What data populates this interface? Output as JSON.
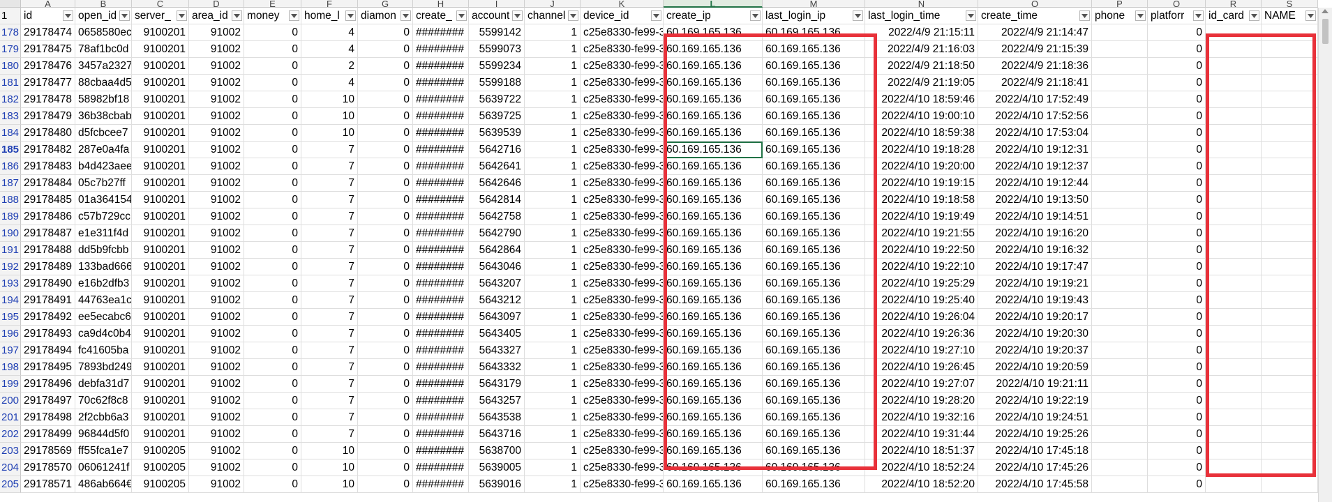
{
  "columns": [
    {
      "letter": "A",
      "header": "id",
      "kind": "num"
    },
    {
      "letter": "B",
      "header": "open_id",
      "kind": "txt"
    },
    {
      "letter": "C",
      "header": "server_",
      "kind": "num"
    },
    {
      "letter": "D",
      "header": "area_id",
      "kind": "num"
    },
    {
      "letter": "E",
      "header": "money",
      "kind": "num"
    },
    {
      "letter": "F",
      "header": "home_l",
      "kind": "num"
    },
    {
      "letter": "G",
      "header": "diamon",
      "kind": "num"
    },
    {
      "letter": "H",
      "header": "create_",
      "kind": "txt"
    },
    {
      "letter": "I",
      "header": "account",
      "kind": "num"
    },
    {
      "letter": "J",
      "header": "channel",
      "kind": "num"
    },
    {
      "letter": "K",
      "header": "device_id",
      "kind": "txt"
    },
    {
      "letter": "L",
      "header": "create_ip",
      "kind": "txt"
    },
    {
      "letter": "M",
      "header": "last_login_ip",
      "kind": "txt"
    },
    {
      "letter": "N",
      "header": "last_login_time",
      "kind": "num"
    },
    {
      "letter": "O",
      "header": "create_time",
      "kind": "num"
    },
    {
      "letter": "P",
      "header": "phone",
      "kind": "txt"
    },
    {
      "letter": "Q",
      "header": "platforr",
      "kind": "num"
    },
    {
      "letter": "R",
      "header": "id_card",
      "kind": "txt"
    },
    {
      "letter": "S",
      "header": "NAME",
      "kind": "txt"
    }
  ],
  "selected_column": "L",
  "active_row": "185",
  "header_row_number": "1",
  "rows": [
    {
      "n": "178",
      "id": "29178474",
      "open_id": "0658580ec",
      "server": "9100201",
      "area": "91002",
      "money": "0",
      "home": "4",
      "diamond": "0",
      "create": "########",
      "account": "5599142",
      "channel": "1",
      "device": "c25e8330-fe99-3",
      "create_ip": "60.169.165.136",
      "last_ip": "60.169.165.136",
      "last_time": "2022/4/9 21:15:11",
      "create_time": "2022/4/9 21:14:47",
      "phone": "",
      "platform": "0",
      "id_card": "",
      "name": ""
    },
    {
      "n": "179",
      "id": "29178475",
      "open_id": "78af1bc0d",
      "server": "9100201",
      "area": "91002",
      "money": "0",
      "home": "4",
      "diamond": "0",
      "create": "########",
      "account": "5599073",
      "channel": "1",
      "device": "c25e8330-fe99-3",
      "create_ip": "60.169.165.136",
      "last_ip": "60.169.165.136",
      "last_time": "2022/4/9 21:16:03",
      "create_time": "2022/4/9 21:15:39",
      "phone": "",
      "platform": "0",
      "id_card": "",
      "name": ""
    },
    {
      "n": "180",
      "id": "29178476",
      "open_id": "3457a2327",
      "server": "9100201",
      "area": "91002",
      "money": "0",
      "home": "2",
      "diamond": "0",
      "create": "########",
      "account": "5599234",
      "channel": "1",
      "device": "c25e8330-fe99-3",
      "create_ip": "60.169.165.136",
      "last_ip": "60.169.165.136",
      "last_time": "2022/4/9 21:18:50",
      "create_time": "2022/4/9 21:18:36",
      "phone": "",
      "platform": "0",
      "id_card": "",
      "name": ""
    },
    {
      "n": "181",
      "id": "29178477",
      "open_id": "88cbaa4d5",
      "server": "9100201",
      "area": "91002",
      "money": "0",
      "home": "4",
      "diamond": "0",
      "create": "########",
      "account": "5599188",
      "channel": "1",
      "device": "c25e8330-fe99-3",
      "create_ip": "60.169.165.136",
      "last_ip": "60.169.165.136",
      "last_time": "2022/4/9 21:19:05",
      "create_time": "2022/4/9 21:18:41",
      "phone": "",
      "platform": "0",
      "id_card": "",
      "name": ""
    },
    {
      "n": "182",
      "id": "29178478",
      "open_id": "58982bf18",
      "server": "9100201",
      "area": "91002",
      "money": "0",
      "home": "10",
      "diamond": "0",
      "create": "########",
      "account": "5639722",
      "channel": "1",
      "device": "c25e8330-fe99-3",
      "create_ip": "60.169.165.136",
      "last_ip": "60.169.165.136",
      "last_time": "2022/4/10 18:59:46",
      "create_time": "2022/4/10 17:52:49",
      "phone": "",
      "platform": "0",
      "id_card": "",
      "name": ""
    },
    {
      "n": "183",
      "id": "29178479",
      "open_id": "36b38cbab",
      "server": "9100201",
      "area": "91002",
      "money": "0",
      "home": "10",
      "diamond": "0",
      "create": "########",
      "account": "5639725",
      "channel": "1",
      "device": "c25e8330-fe99-3",
      "create_ip": "60.169.165.136",
      "last_ip": "60.169.165.136",
      "last_time": "2022/4/10 19:00:10",
      "create_time": "2022/4/10 17:52:56",
      "phone": "",
      "platform": "0",
      "id_card": "",
      "name": ""
    },
    {
      "n": "184",
      "id": "29178480",
      "open_id": "d5fcbcee7",
      "server": "9100201",
      "area": "91002",
      "money": "0",
      "home": "10",
      "diamond": "0",
      "create": "########",
      "account": "5639539",
      "channel": "1",
      "device": "c25e8330-fe99-3",
      "create_ip": "60.169.165.136",
      "last_ip": "60.169.165.136",
      "last_time": "2022/4/10 18:59:38",
      "create_time": "2022/4/10 17:53:04",
      "phone": "",
      "platform": "0",
      "id_card": "",
      "name": ""
    },
    {
      "n": "185",
      "id": "29178482",
      "open_id": "287e0a4fa",
      "server": "9100201",
      "area": "91002",
      "money": "0",
      "home": "7",
      "diamond": "0",
      "create": "########",
      "account": "5642716",
      "channel": "1",
      "device": "c25e8330-fe99-3",
      "create_ip": "60.169.165.136",
      "last_ip": "60.169.165.136",
      "last_time": "2022/4/10 19:18:28",
      "create_time": "2022/4/10 19:12:31",
      "phone": "",
      "platform": "0",
      "id_card": "",
      "name": ""
    },
    {
      "n": "186",
      "id": "29178483",
      "open_id": "b4d423aee",
      "server": "9100201",
      "area": "91002",
      "money": "0",
      "home": "7",
      "diamond": "0",
      "create": "########",
      "account": "5642641",
      "channel": "1",
      "device": "c25e8330-fe99-3",
      "create_ip": "60.169.165.136",
      "last_ip": "60.169.165.136",
      "last_time": "2022/4/10 19:20:00",
      "create_time": "2022/4/10 19:12:37",
      "phone": "",
      "platform": "0",
      "id_card": "",
      "name": ""
    },
    {
      "n": "187",
      "id": "29178484",
      "open_id": "05c7b27ff",
      "server": "9100201",
      "area": "91002",
      "money": "0",
      "home": "7",
      "diamond": "0",
      "create": "########",
      "account": "5642646",
      "channel": "1",
      "device": "c25e8330-fe99-3",
      "create_ip": "60.169.165.136",
      "last_ip": "60.169.165.136",
      "last_time": "2022/4/10 19:19:15",
      "create_time": "2022/4/10 19:12:44",
      "phone": "",
      "platform": "0",
      "id_card": "",
      "name": ""
    },
    {
      "n": "188",
      "id": "29178485",
      "open_id": "01a364154",
      "server": "9100201",
      "area": "91002",
      "money": "0",
      "home": "7",
      "diamond": "0",
      "create": "########",
      "account": "5642814",
      "channel": "1",
      "device": "c25e8330-fe99-3",
      "create_ip": "60.169.165.136",
      "last_ip": "60.169.165.136",
      "last_time": "2022/4/10 19:18:58",
      "create_time": "2022/4/10 19:13:50",
      "phone": "",
      "platform": "0",
      "id_card": "",
      "name": ""
    },
    {
      "n": "189",
      "id": "29178486",
      "open_id": "c57b729cc",
      "server": "9100201",
      "area": "91002",
      "money": "0",
      "home": "7",
      "diamond": "0",
      "create": "########",
      "account": "5642758",
      "channel": "1",
      "device": "c25e8330-fe99-3",
      "create_ip": "60.169.165.136",
      "last_ip": "60.169.165.136",
      "last_time": "2022/4/10 19:19:49",
      "create_time": "2022/4/10 19:14:51",
      "phone": "",
      "platform": "0",
      "id_card": "",
      "name": ""
    },
    {
      "n": "190",
      "id": "29178487",
      "open_id": "e1e311f4d",
      "server": "9100201",
      "area": "91002",
      "money": "0",
      "home": "7",
      "diamond": "0",
      "create": "########",
      "account": "5642790",
      "channel": "1",
      "device": "c25e8330-fe99-3",
      "create_ip": "60.169.165.136",
      "last_ip": "60.169.165.136",
      "last_time": "2022/4/10 19:21:55",
      "create_time": "2022/4/10 19:16:20",
      "phone": "",
      "platform": "0",
      "id_card": "",
      "name": ""
    },
    {
      "n": "191",
      "id": "29178488",
      "open_id": "dd5b9fcbb",
      "server": "9100201",
      "area": "91002",
      "money": "0",
      "home": "7",
      "diamond": "0",
      "create": "########",
      "account": "5642864",
      "channel": "1",
      "device": "c25e8330-fe99-3",
      "create_ip": "60.169.165.136",
      "last_ip": "60.169.165.136",
      "last_time": "2022/4/10 19:22:50",
      "create_time": "2022/4/10 19:16:32",
      "phone": "",
      "platform": "0",
      "id_card": "",
      "name": ""
    },
    {
      "n": "192",
      "id": "29178489",
      "open_id": "133bad666",
      "server": "9100201",
      "area": "91002",
      "money": "0",
      "home": "7",
      "diamond": "0",
      "create": "########",
      "account": "5643046",
      "channel": "1",
      "device": "c25e8330-fe99-3",
      "create_ip": "60.169.165.136",
      "last_ip": "60.169.165.136",
      "last_time": "2022/4/10 19:22:10",
      "create_time": "2022/4/10 19:17:47",
      "phone": "",
      "platform": "0",
      "id_card": "",
      "name": ""
    },
    {
      "n": "193",
      "id": "29178490",
      "open_id": "e16b2dfb3",
      "server": "9100201",
      "area": "91002",
      "money": "0",
      "home": "7",
      "diamond": "0",
      "create": "########",
      "account": "5643207",
      "channel": "1",
      "device": "c25e8330-fe99-3",
      "create_ip": "60.169.165.136",
      "last_ip": "60.169.165.136",
      "last_time": "2022/4/10 19:25:29",
      "create_time": "2022/4/10 19:19:21",
      "phone": "",
      "platform": "0",
      "id_card": "",
      "name": ""
    },
    {
      "n": "194",
      "id": "29178491",
      "open_id": "44763ea1c",
      "server": "9100201",
      "area": "91002",
      "money": "0",
      "home": "7",
      "diamond": "0",
      "create": "########",
      "account": "5643212",
      "channel": "1",
      "device": "c25e8330-fe99-3",
      "create_ip": "60.169.165.136",
      "last_ip": "60.169.165.136",
      "last_time": "2022/4/10 19:25:40",
      "create_time": "2022/4/10 19:19:43",
      "phone": "",
      "platform": "0",
      "id_card": "",
      "name": ""
    },
    {
      "n": "195",
      "id": "29178492",
      "open_id": "ee5ecabc6",
      "server": "9100201",
      "area": "91002",
      "money": "0",
      "home": "7",
      "diamond": "0",
      "create": "########",
      "account": "5643097",
      "channel": "1",
      "device": "c25e8330-fe99-3",
      "create_ip": "60.169.165.136",
      "last_ip": "60.169.165.136",
      "last_time": "2022/4/10 19:26:04",
      "create_time": "2022/4/10 19:20:17",
      "phone": "",
      "platform": "0",
      "id_card": "",
      "name": ""
    },
    {
      "n": "196",
      "id": "29178493",
      "open_id": "ca9d4c0b4",
      "server": "9100201",
      "area": "91002",
      "money": "0",
      "home": "7",
      "diamond": "0",
      "create": "########",
      "account": "5643405",
      "channel": "1",
      "device": "c25e8330-fe99-3",
      "create_ip": "60.169.165.136",
      "last_ip": "60.169.165.136",
      "last_time": "2022/4/10 19:26:36",
      "create_time": "2022/4/10 19:20:30",
      "phone": "",
      "platform": "0",
      "id_card": "",
      "name": ""
    },
    {
      "n": "197",
      "id": "29178494",
      "open_id": "fc41605ba",
      "server": "9100201",
      "area": "91002",
      "money": "0",
      "home": "7",
      "diamond": "0",
      "create": "########",
      "account": "5643327",
      "channel": "1",
      "device": "c25e8330-fe99-3",
      "create_ip": "60.169.165.136",
      "last_ip": "60.169.165.136",
      "last_time": "2022/4/10 19:27:10",
      "create_time": "2022/4/10 19:20:37",
      "phone": "",
      "platform": "0",
      "id_card": "",
      "name": ""
    },
    {
      "n": "198",
      "id": "29178495",
      "open_id": "7893bd249",
      "server": "9100201",
      "area": "91002",
      "money": "0",
      "home": "7",
      "diamond": "0",
      "create": "########",
      "account": "5643332",
      "channel": "1",
      "device": "c25e8330-fe99-3",
      "create_ip": "60.169.165.136",
      "last_ip": "60.169.165.136",
      "last_time": "2022/4/10 19:26:45",
      "create_time": "2022/4/10 19:20:59",
      "phone": "",
      "platform": "0",
      "id_card": "",
      "name": ""
    },
    {
      "n": "199",
      "id": "29178496",
      "open_id": "debfa31d7",
      "server": "9100201",
      "area": "91002",
      "money": "0",
      "home": "7",
      "diamond": "0",
      "create": "########",
      "account": "5643179",
      "channel": "1",
      "device": "c25e8330-fe99-3",
      "create_ip": "60.169.165.136",
      "last_ip": "60.169.165.136",
      "last_time": "2022/4/10 19:27:07",
      "create_time": "2022/4/10 19:21:11",
      "phone": "",
      "platform": "0",
      "id_card": "",
      "name": ""
    },
    {
      "n": "200",
      "id": "29178497",
      "open_id": "70c62f8c8",
      "server": "9100201",
      "area": "91002",
      "money": "0",
      "home": "7",
      "diamond": "0",
      "create": "########",
      "account": "5643257",
      "channel": "1",
      "device": "c25e8330-fe99-3",
      "create_ip": "60.169.165.136",
      "last_ip": "60.169.165.136",
      "last_time": "2022/4/10 19:28:20",
      "create_time": "2022/4/10 19:22:19",
      "phone": "",
      "platform": "0",
      "id_card": "",
      "name": ""
    },
    {
      "n": "201",
      "id": "29178498",
      "open_id": "2f2cbb6a3",
      "server": "9100201",
      "area": "91002",
      "money": "0",
      "home": "7",
      "diamond": "0",
      "create": "########",
      "account": "5643538",
      "channel": "1",
      "device": "c25e8330-fe99-3",
      "create_ip": "60.169.165.136",
      "last_ip": "60.169.165.136",
      "last_time": "2022/4/10 19:32:16",
      "create_time": "2022/4/10 19:24:51",
      "phone": "",
      "platform": "0",
      "id_card": "",
      "name": ""
    },
    {
      "n": "202",
      "id": "29178499",
      "open_id": "96844d5f0",
      "server": "9100201",
      "area": "91002",
      "money": "0",
      "home": "7",
      "diamond": "0",
      "create": "########",
      "account": "5643716",
      "channel": "1",
      "device": "c25e8330-fe99-3",
      "create_ip": "60.169.165.136",
      "last_ip": "60.169.165.136",
      "last_time": "2022/4/10 19:31:44",
      "create_time": "2022/4/10 19:25:26",
      "phone": "",
      "platform": "0",
      "id_card": "",
      "name": ""
    },
    {
      "n": "203",
      "id": "29178569",
      "open_id": "ff55fca1e7",
      "server": "9100205",
      "area": "91002",
      "money": "0",
      "home": "10",
      "diamond": "0",
      "create": "########",
      "account": "5638700",
      "channel": "1",
      "device": "c25e8330-fe99-3",
      "create_ip": "60.169.165.136",
      "last_ip": "60.169.165.136",
      "last_time": "2022/4/10 18:51:37",
      "create_time": "2022/4/10 17:45:18",
      "phone": "",
      "platform": "0",
      "id_card": "",
      "name": ""
    },
    {
      "n": "204",
      "id": "29178570",
      "open_id": "06061241f",
      "server": "9100205",
      "area": "91002",
      "money": "0",
      "home": "10",
      "diamond": "0",
      "create": "########",
      "account": "5639005",
      "channel": "1",
      "device": "c25e8330-fe99-3",
      "create_ip": "60.169.165.136",
      "last_ip": "60.169.165.136",
      "last_time": "2022/4/10 18:52:24",
      "create_time": "2022/4/10 17:45:26",
      "phone": "",
      "platform": "0",
      "id_card": "",
      "name": ""
    },
    {
      "n": "205",
      "id": "29178571",
      "open_id": "486ab664€",
      "server": "9100205",
      "area": "91002",
      "money": "0",
      "home": "10",
      "diamond": "0",
      "create": "########",
      "account": "5639016",
      "channel": "1",
      "device": "c25e8330-fe99-3",
      "create_ip": "60.169.165.136",
      "last_ip": "60.169.165.136",
      "last_time": "2022/4/10 18:52:20",
      "create_time": "2022/4/10 17:45:58",
      "phone": "",
      "platform": "0",
      "id_card": "",
      "name": ""
    }
  ],
  "field_order": [
    "id",
    "open_id",
    "server",
    "area",
    "money",
    "home",
    "diamond",
    "create",
    "account",
    "channel",
    "device",
    "create_ip",
    "last_ip",
    "last_time",
    "create_time",
    "phone",
    "platform",
    "id_card",
    "name"
  ],
  "highlight_color": "#e8313a",
  "selection_color": "#217346"
}
